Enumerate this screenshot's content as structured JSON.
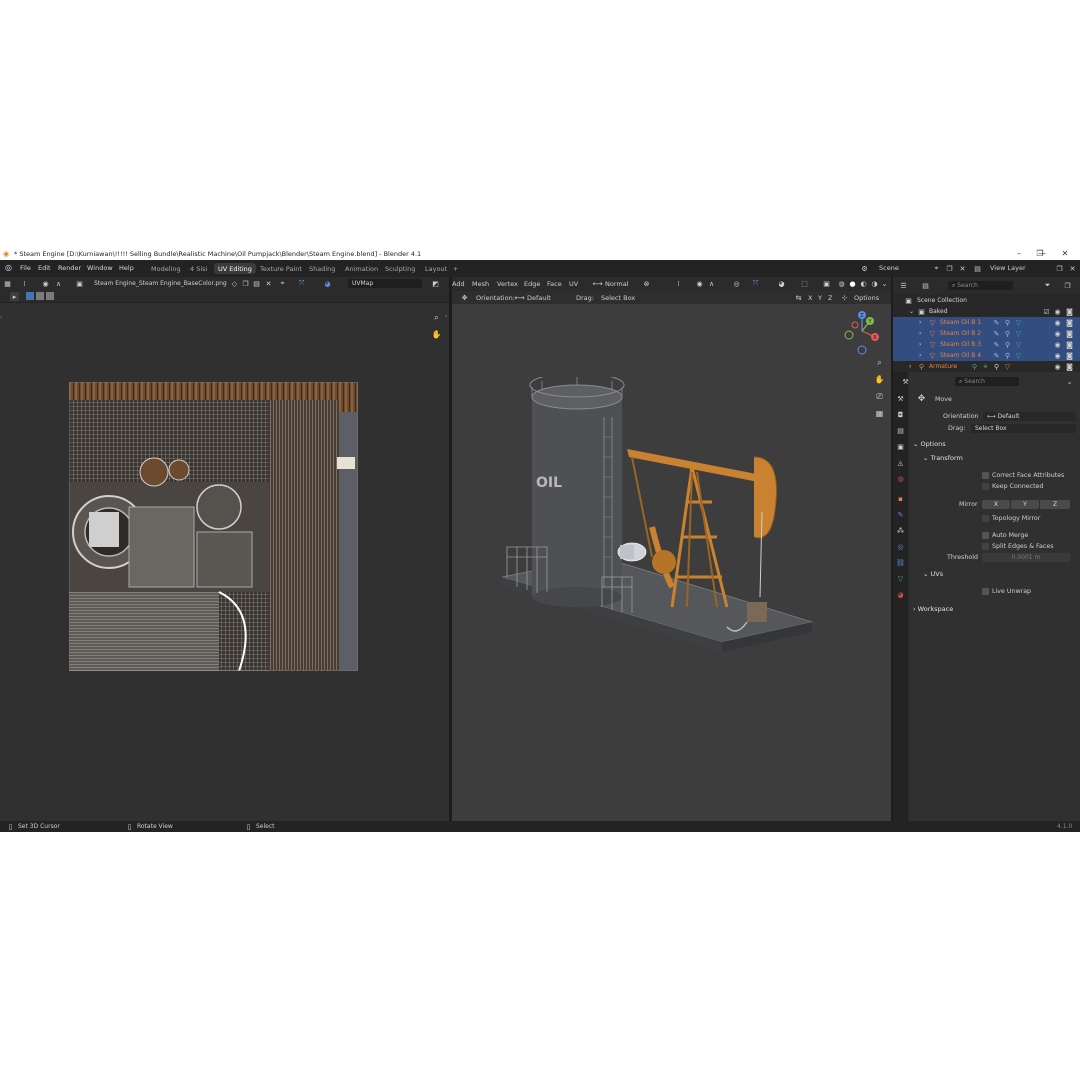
{
  "window": {
    "title": "* Steam Engine [D:\\Kurniawan\\!!!!! Selling Bundle\\Realistic Machine\\Oil Pumpjack\\Blender\\Steam Engine.blend] - Blender 4.1",
    "minimize": "—",
    "maximize": "❐",
    "close": "✕"
  },
  "menu": {
    "items": [
      "File",
      "Edit",
      "Render",
      "Window",
      "Help"
    ]
  },
  "workspaces": {
    "tabs": [
      "Modeling",
      "4 Sisi",
      "UV Editing",
      "Texture Paint",
      "Shading",
      "Animation",
      "Sculpting",
      "Layout"
    ],
    "active": "UV Editing",
    "add": "+"
  },
  "scene": {
    "label": "Scene",
    "view_layer": "View Layer"
  },
  "uv_editor": {
    "image_name": "Steam Engine_Steam Engine_BaseColor.png",
    "uv_map": "UVMap"
  },
  "viewport": {
    "menus": [
      "Add",
      "Mesh",
      "Vertex",
      "Edge",
      "Face",
      "UV"
    ],
    "transform_orientation": "Normal",
    "orientation_label": "Orientation:",
    "orientation_value": "Default",
    "drag_label": "Drag:",
    "drag_value": "Select Box",
    "axes": [
      "X",
      "Y",
      "Z"
    ],
    "options": "Options",
    "tank_text": "OIL"
  },
  "outliner": {
    "search_placeholder": "Search",
    "root": "Scene Collection",
    "collection": "Baked",
    "objects": [
      "Steam Oil B 1",
      "Steam Oil B 2",
      "Steam Oil B 3",
      "Steam Oil B 4"
    ],
    "armature": "Armature"
  },
  "properties": {
    "search_placeholder": "Search",
    "tool": "Move",
    "orientation_label": "Orientation",
    "orientation_value": "Default",
    "drag_label": "Drag:",
    "drag_value": "Select Box",
    "options_panel": "Options",
    "transform_panel": "Transform",
    "correct_face": "Correct Face Attributes",
    "keep_connected": "Keep Connected",
    "mirror_label": "Mirror",
    "mirror_axes": [
      "X",
      "Y",
      "Z"
    ],
    "topology_mirror": "Topology Mirror",
    "auto_merge": "Auto Merge",
    "split_edges": "Split Edges & Faces",
    "threshold_label": "Threshold",
    "threshold_value": "0.0001 m",
    "uvs_panel": "UVs",
    "live_unwrap": "Live Unwrap",
    "workspace_panel": "Workspace"
  },
  "statusbar": {
    "items": [
      "Set 3D Cursor",
      "Rotate View",
      "Select"
    ],
    "version": "4.1.0"
  },
  "colors": {
    "selection": "#334d80",
    "accent": "#4772b3",
    "orange_object": "#e8843a",
    "green_mesh": "#3fae7e"
  }
}
